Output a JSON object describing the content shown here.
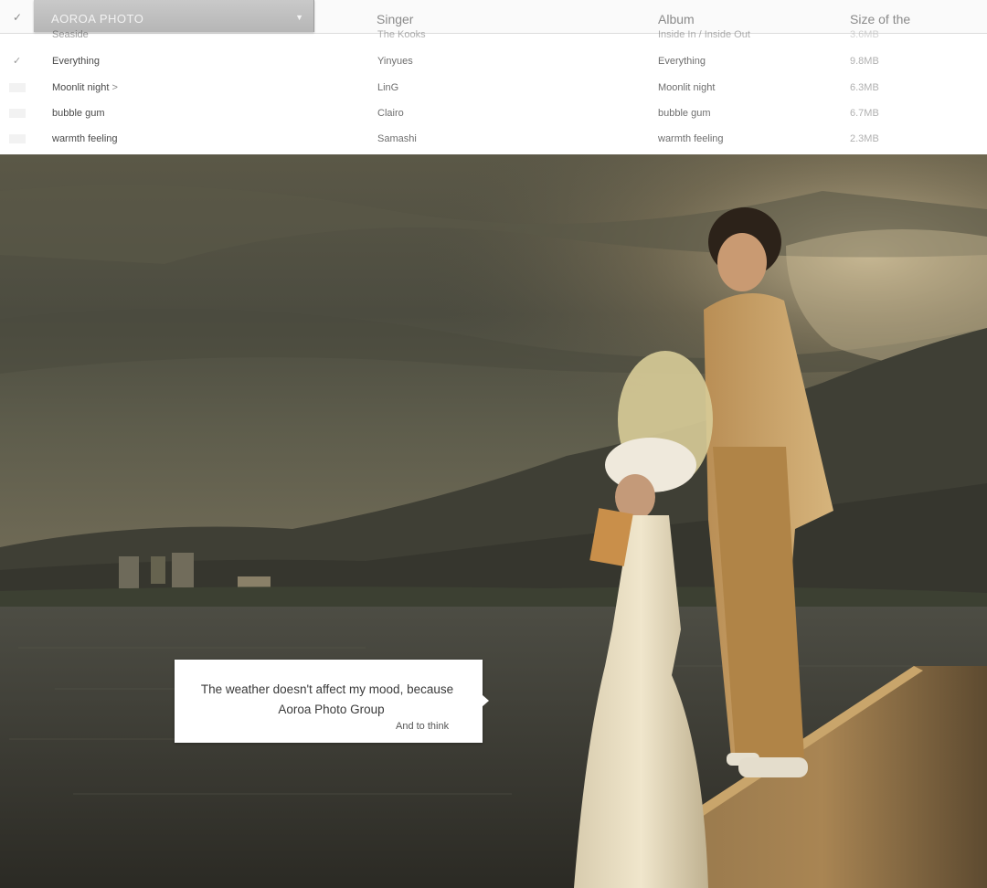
{
  "header": {
    "title": "AOROA PHOTO",
    "check_icon": "check-icon",
    "dropdown_icon": "chevron-down-icon",
    "columns": {
      "singer": "Singer",
      "album": "Album",
      "size": "Size of the"
    }
  },
  "songs": [
    {
      "title": "Seaside",
      "singer": "The Kooks",
      "album": "Inside In / Inside Out",
      "size": "3.6MB",
      "checked": false
    },
    {
      "title": "Everything",
      "singer": "Yinyues",
      "album": "Everything",
      "size": "9.8MB",
      "checked": true
    },
    {
      "title": "Moonlit night",
      "singer": "LinG",
      "album": "Moonlit night",
      "size": "6.3MB",
      "checked": false,
      "arrow": ">"
    },
    {
      "title": "bubble gum",
      "singer": "Clairo",
      "album": "bubble gum",
      "size": "6.7MB",
      "checked": false
    },
    {
      "title": "warmth feeling",
      "singer": "Samashi",
      "album": "warmth feeling",
      "size": "2.3MB",
      "checked": false
    }
  ],
  "caption": {
    "line1": "The weather doesn't affect my mood, because",
    "line2": "Aoroa Photo Group",
    "line3": "And to think"
  },
  "colors": {
    "panel_bg": "#ffffff",
    "header_box": "#bdbdbd",
    "sky": "#4a4b40",
    "sunlight": "#c9a45a",
    "water": "#363630"
  }
}
